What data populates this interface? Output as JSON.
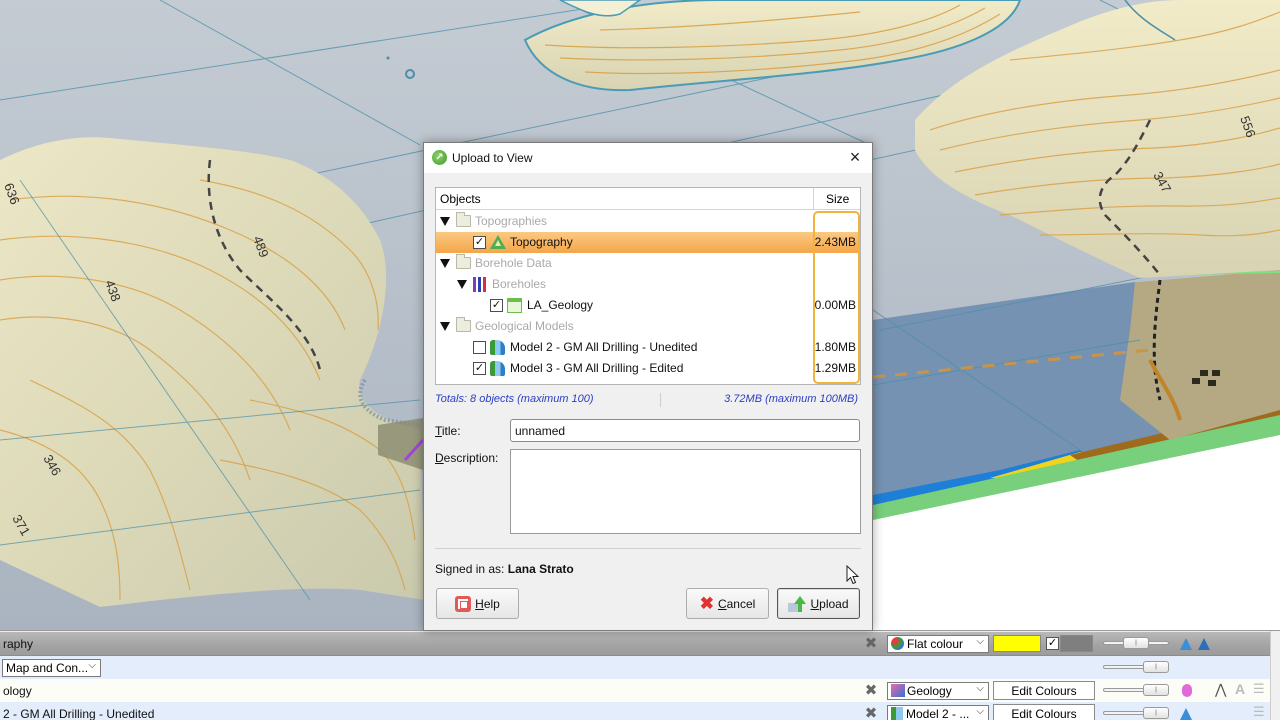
{
  "dialog": {
    "title": "Upload to View",
    "close_label": "×",
    "table": {
      "col_objects": "Objects",
      "col_size": "Size",
      "rows": [
        {
          "type": "group",
          "label": "Topographies",
          "expanded": true
        },
        {
          "type": "item",
          "label": "Topography",
          "checked": true,
          "checkmark": "✓",
          "size": "2.43MB",
          "icon": "topography-icon",
          "selected": true
        },
        {
          "type": "group",
          "label": "Borehole Data",
          "expanded": true
        },
        {
          "type": "subgroup",
          "label": "Boreholes",
          "expanded": true,
          "icon": "boreholes-icon"
        },
        {
          "type": "item",
          "label": "LA_Geology",
          "checked": true,
          "checkmark": "✓",
          "size": "0.00MB",
          "icon": "table-icon"
        },
        {
          "type": "group",
          "label": "Geological Models",
          "expanded": true
        },
        {
          "type": "item",
          "label": "Model 2 - GM All Drilling - Unedited",
          "checked": false,
          "checkmark": "",
          "size": "1.80MB",
          "icon": "geomodel-icon"
        },
        {
          "type": "item",
          "label": "Model 3 - GM All Drilling - Edited",
          "checked": true,
          "checkmark": "✓",
          "size": "1.29MB",
          "icon": "geomodel-icon"
        }
      ]
    },
    "totals": {
      "objects": "Totals:  8 objects (maximum 100)",
      "size": "3.72MB (maximum 100MB)"
    },
    "title_label": "Title:",
    "title_value": "unnamed",
    "description_label": "Description:",
    "description_value": "",
    "signed_in_prefix": "Signed in as:",
    "signed_in_user": "Lana Strato",
    "buttons": {
      "help": "Help",
      "cancel": "Cancel",
      "upload": "Upload"
    },
    "highlight_color": "#f2b33d"
  },
  "shape_panel": {
    "rows": [
      {
        "label": "raphy",
        "display": "Flat colour",
        "color": "#ffff00",
        "checked": true,
        "checkmark": "✓",
        "secondary_color": "#7f7f7f"
      },
      {
        "label": "",
        "texture": "Map and Con..."
      },
      {
        "label": "ology",
        "display": "Geology",
        "button": "Edit Colours"
      },
      {
        "label": "2 - GM All Drilling - Unedited",
        "display": "Model 2 - ...",
        "button": "Edit Colours"
      }
    ],
    "remove_glyph": "✖",
    "dropdown_caret": "⌵"
  },
  "scene": {
    "contour_labels": [
      "636",
      "489",
      "438",
      "346",
      "371",
      "556",
      "347"
    ],
    "colors": {
      "water": "#b8c2cd",
      "terrain": "#e8e4c4",
      "contours": "#d9a24a",
      "grid": "#4a8fa8",
      "cross_section_green": "#78cf7c",
      "cross_section_blue": "#1e7fd8",
      "cross_section_brown": "#a06a1c",
      "cross_section_yellow": "#f0d41c"
    }
  }
}
